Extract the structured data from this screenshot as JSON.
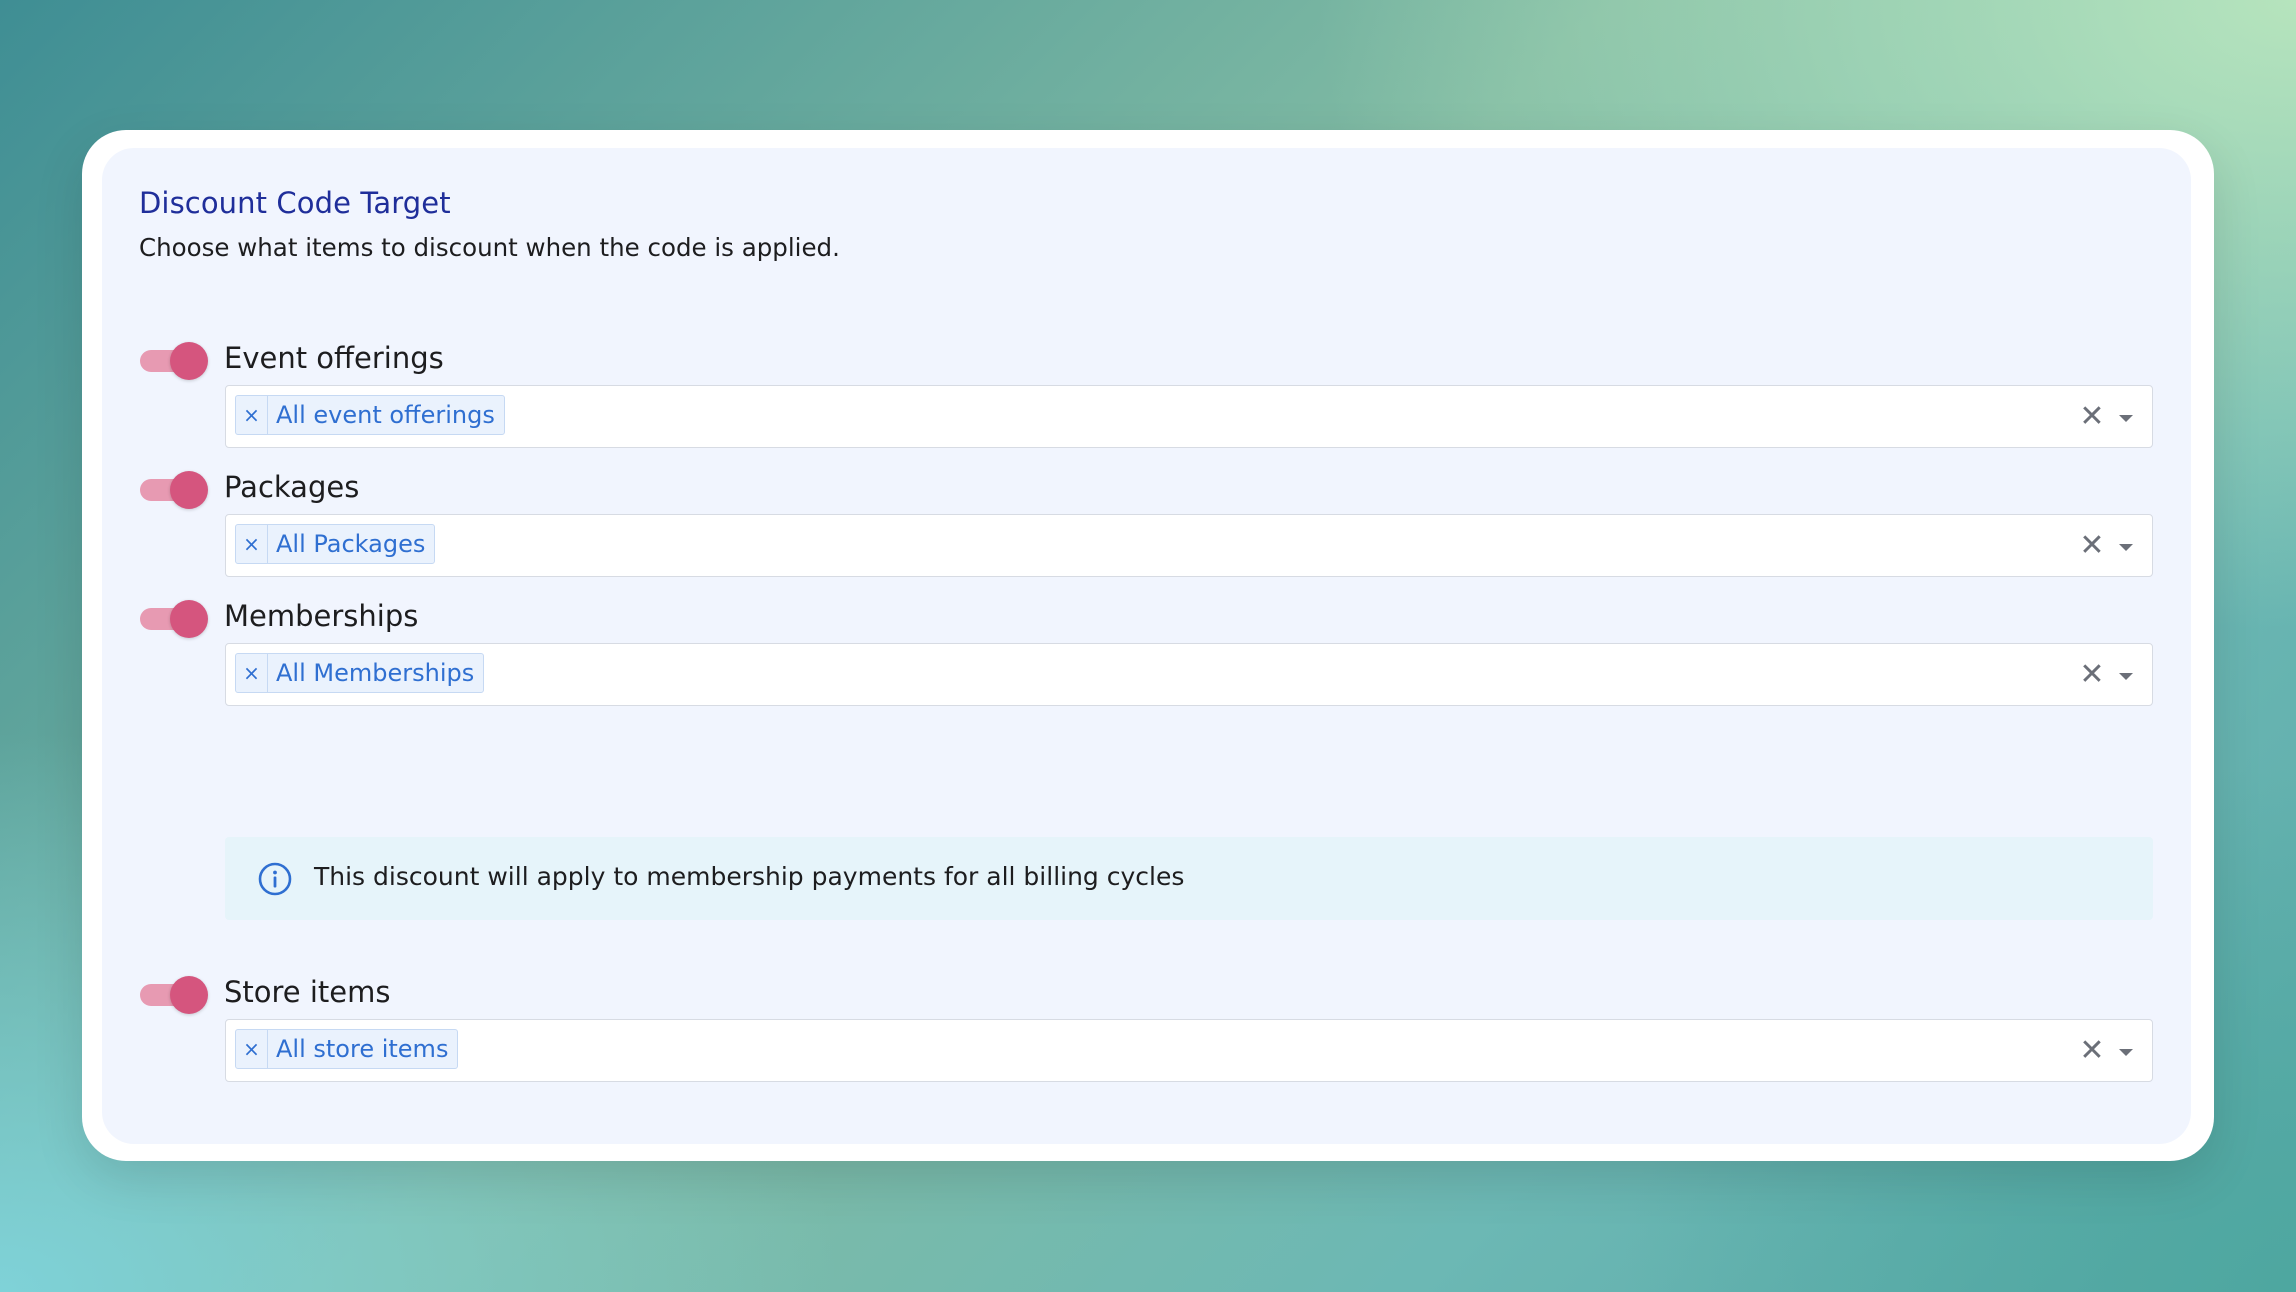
{
  "header": {
    "title": "Discount Code Target",
    "subtitle": "Choose what items to discount when the code is applied."
  },
  "sections": [
    {
      "label": "Event offerings",
      "enabled": true,
      "chip": "All event offerings"
    },
    {
      "label": "Packages",
      "enabled": true,
      "chip": "All Packages"
    },
    {
      "label": "Memberships",
      "enabled": true,
      "chip": "All Memberships"
    },
    {
      "label": "Store items",
      "enabled": true,
      "chip": "All store items"
    }
  ],
  "membership_note": "This discount will apply to membership payments for all billing cycles",
  "icons": {
    "chip_remove": "×",
    "clear": "✕",
    "dropdown": "caret-down-icon",
    "info": "info-circle-icon"
  },
  "colors": {
    "title": "#1f2e9a",
    "toggle_on": "#d5557e",
    "toggle_track": "#e79ab2",
    "chip_text": "#2f6fd1",
    "info_bg": "#e6f4fa"
  }
}
